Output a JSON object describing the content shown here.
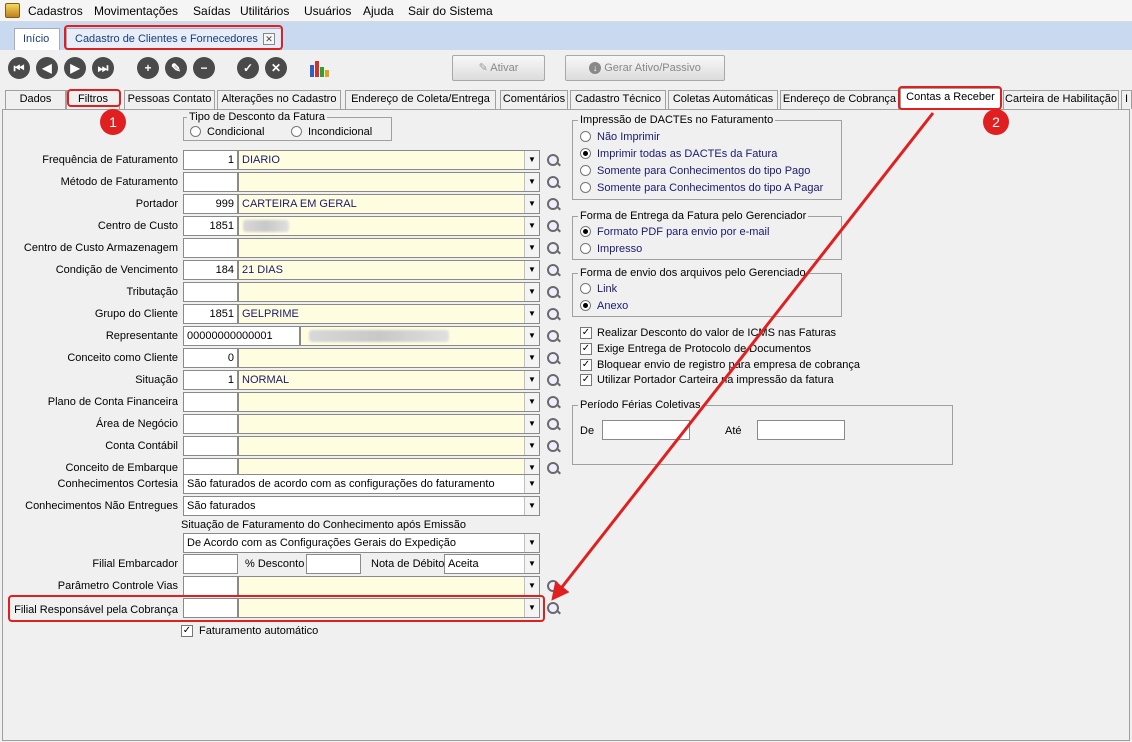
{
  "menu": [
    "Cadastros",
    "Movimentações",
    "Saídas",
    "Utilitários",
    "Usuários",
    "Ajuda",
    "Sair do Sistema"
  ],
  "doc_tabs": {
    "inicio": "Início",
    "cadastro": "Cadastro de Clientes e Fornecedores"
  },
  "toolbar": {
    "ativar": "Ativar",
    "gerar": "Gerar Ativo/Passivo"
  },
  "section_tabs": [
    "Dados",
    "Filtros",
    "Pessoas Contato",
    "Alterações no Cadastro",
    "Endereço de Coleta/Entrega",
    "Comentários",
    "Cadastro Técnico",
    "Coletas Automáticas",
    "Endereço de Cobrança",
    "Contas a Receber",
    "Carteira de Habilitação",
    "I"
  ],
  "annotations": {
    "badge1": "1",
    "badge2": "2"
  },
  "tipo_desconto": {
    "title": "Tipo de Desconto da Fatura",
    "opt1": "Condicional",
    "opt2": "Incondicional"
  },
  "fields": {
    "freq": {
      "label": "Frequência de Faturamento",
      "code": "1",
      "value": "DIARIO"
    },
    "metodo": {
      "label": "Método de Faturamento",
      "code": "",
      "value": ""
    },
    "portador": {
      "label": "Portador",
      "code": "999",
      "value": "CARTEIRA EM GERAL"
    },
    "centro_custo": {
      "label": "Centro de Custo",
      "code": "1851",
      "value": ""
    },
    "centro_arm": {
      "label": "Centro de Custo Armazenagem",
      "code": "",
      "value": ""
    },
    "condicao": {
      "label": "Condição de Vencimento",
      "code": "184",
      "value": "21 DIAS"
    },
    "tributacao": {
      "label": "Tributação",
      "code": "",
      "value": ""
    },
    "grupo": {
      "label": "Grupo do Cliente",
      "code": "1851",
      "value": "GELPRIME"
    },
    "representante": {
      "label": "Representante",
      "code": "00000000000001",
      "value": ""
    },
    "conceito": {
      "label": "Conceito como Cliente",
      "code": "0",
      "value": ""
    },
    "situacao": {
      "label": "Situação",
      "code": "1",
      "value": "NORMAL"
    },
    "plano": {
      "label": "Plano de Conta Financeira",
      "code": "",
      "value": ""
    },
    "area": {
      "label": "Área de Negócio",
      "code": "",
      "value": ""
    },
    "conta": {
      "label": "Conta Contábil",
      "code": "",
      "value": ""
    },
    "conceito_emb": {
      "label": "Conceito de Embarque",
      "code": "",
      "value": ""
    },
    "cortesia": {
      "label": "Conhecimentos Cortesia",
      "value": "São faturados de acordo com as configurações do faturamento"
    },
    "nao_entregues": {
      "label": "Conhecimentos Não Entregues",
      "value": "São faturados"
    },
    "situacao_fat": {
      "label": "Situação de Faturamento do Conhecimento após Emissão",
      "value": "De Acordo com as Configurações Gerais do Expedição"
    },
    "filial_emb": {
      "label": "Filial Embarcador",
      "desconto_label": "% Desconto",
      "nota_label": "Nota de Débito",
      "nota_value": "Aceita"
    },
    "parametro": {
      "label": "Parâmetro Controle Vias"
    },
    "filial_resp": {
      "label": "Filial Responsável pela Cobrança"
    },
    "fat_auto": {
      "label": "Faturamento automático"
    }
  },
  "dactes": {
    "title": "Impressão de DACTEs no Faturamento",
    "options": [
      "Não Imprimir",
      "Imprimir todas as DACTEs da Fatura",
      "Somente para Conhecimentos do tipo Pago",
      "Somente para Conhecimentos do tipo A Pagar"
    ]
  },
  "forma_entrega": {
    "title": "Forma de Entrega da Fatura pelo Gerenciador",
    "options": [
      "Formato PDF para envio por e-mail",
      "Impresso"
    ]
  },
  "forma_envio": {
    "title": "Forma de envio dos arquivos pelo Gerenciado",
    "options": [
      "Link",
      "Anexo"
    ]
  },
  "checks": [
    "Realizar Desconto do valor de ICMS nas Faturas",
    "Exige Entrega de Protocolo de Documentos",
    "Bloquear envio de registro para empresa de cobrança",
    "Utilizar Portador Carteira na impressão da fatura"
  ],
  "ferias": {
    "title": "Período Férias Coletivas",
    "de": "De",
    "ate": "Até"
  },
  "colors": {
    "annotation": "#e02020",
    "tab_bar": "#c9d9ef",
    "combo_bg": "#fffde0"
  }
}
